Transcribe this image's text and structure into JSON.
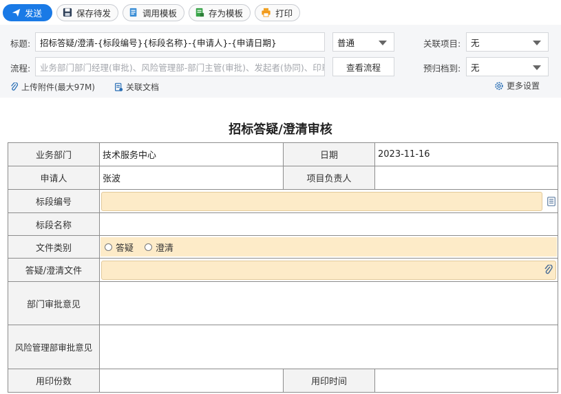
{
  "toolbar": {
    "send": "发送",
    "save_draft": "保存待发",
    "use_template": "调用模板",
    "save_template": "存为模板",
    "print": "打印"
  },
  "header": {
    "title_label": "标题:",
    "title_value": "招标答疑/澄清-{标段编号}{标段名称}-{申请人}-{申请日期}",
    "priority_value": "普通",
    "related_project_label": "关联项目:",
    "related_project_value": "无",
    "flow_label": "流程:",
    "flow_value": "业务部门部门经理(审批)、风险管理部-部门主管(审批)、发起者(协同)、印章管",
    "view_flow": "查看流程",
    "archive_label": "预归档到:",
    "archive_value": "无",
    "attach_label": "上传附件(最大97M)",
    "related_doc_label": "关联文档",
    "more_settings": "更多设置"
  },
  "form": {
    "title": "招标答疑/澄清审核",
    "dept_label": "业务部门",
    "dept_value": "技术服务中心",
    "date_label": "日期",
    "date_value": "2023-11-16",
    "applicant_label": "申请人",
    "applicant_value": "张波",
    "pm_label": "项目负责人",
    "pm_value": "",
    "section_no_label": "标段编号",
    "section_name_label": "标段名称",
    "file_type_label": "文件类别",
    "file_type_options": [
      "答疑",
      "澄清"
    ],
    "file_label": "答疑/澄清文件",
    "dept_opinion_label": "部门审批意见",
    "risk_opinion_label": "风险管理部审批意见",
    "seal_count_label": "用印份数",
    "seal_time_label": "用印时间"
  },
  "colors": {
    "primary": "#1a7ae6",
    "highlight": "#fdebc8"
  }
}
